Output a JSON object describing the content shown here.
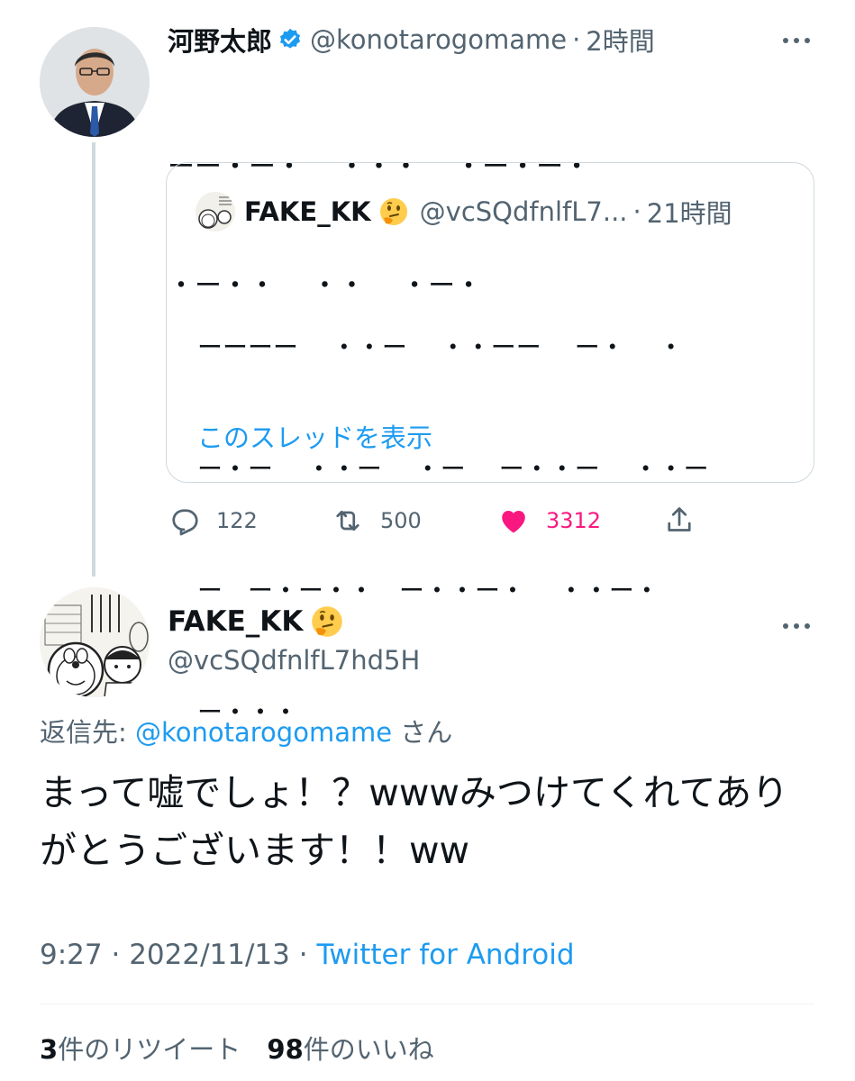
{
  "tweet": {
    "author_name": "河野太郎",
    "author_handle": "@konotarogomame",
    "separator": "·",
    "time_ago": "2時間",
    "lines": [
      "ーー・ー・　 ・・・ 　・ー・ー・",
      "・ー・・ 　・・ 　・ー・"
    ],
    "quoted": {
      "author_name": "FAKE_KK",
      "author_handle": "@vcSQdfnlfL7...",
      "separator": "·",
      "time_ago": "21時間",
      "lines": [
        "ーーーー 　・・ー　 ・・ーー　 ー・　 ・",
        "ー・ー　 ・・ー　 ・ー　 ー・・ー　 ・・ー",
        "ー　ー・ー・・　ー・・ー・　 ・・ー・",
        "ー・・・"
      ],
      "show_thread": "このスレッドを表示"
    },
    "actions": {
      "reply_count": "122",
      "retweet_count": "500",
      "like_count": "3312"
    }
  },
  "reply": {
    "author_name": "FAKE_KK",
    "author_handle": "@vcSQdfnlfL7hd5H",
    "reply_prefix": "返信先:",
    "reply_handle": "@konotarogomame",
    "reply_suffix": "さん",
    "text": "まって嘘でしょ！？wwwみつけてくれてありがとうございます！！ww",
    "time": "9:27",
    "separator": "·",
    "date": "2022/11/13",
    "client": "Twitter for Android",
    "retweets_count": "3",
    "retweets_label": "件のリツイート",
    "likes_count": "98",
    "likes_label": "件のいいね"
  },
  "colors": {
    "accent": "#1d9bf0",
    "like": "#f91880",
    "muted": "#536471",
    "text": "#0f1419",
    "border": "#cfd9de"
  },
  "icons": [
    "verified-badge-icon",
    "thinking-face-emoji",
    "more-icon",
    "reply-icon",
    "retweet-icon",
    "like-icon",
    "share-icon"
  ]
}
